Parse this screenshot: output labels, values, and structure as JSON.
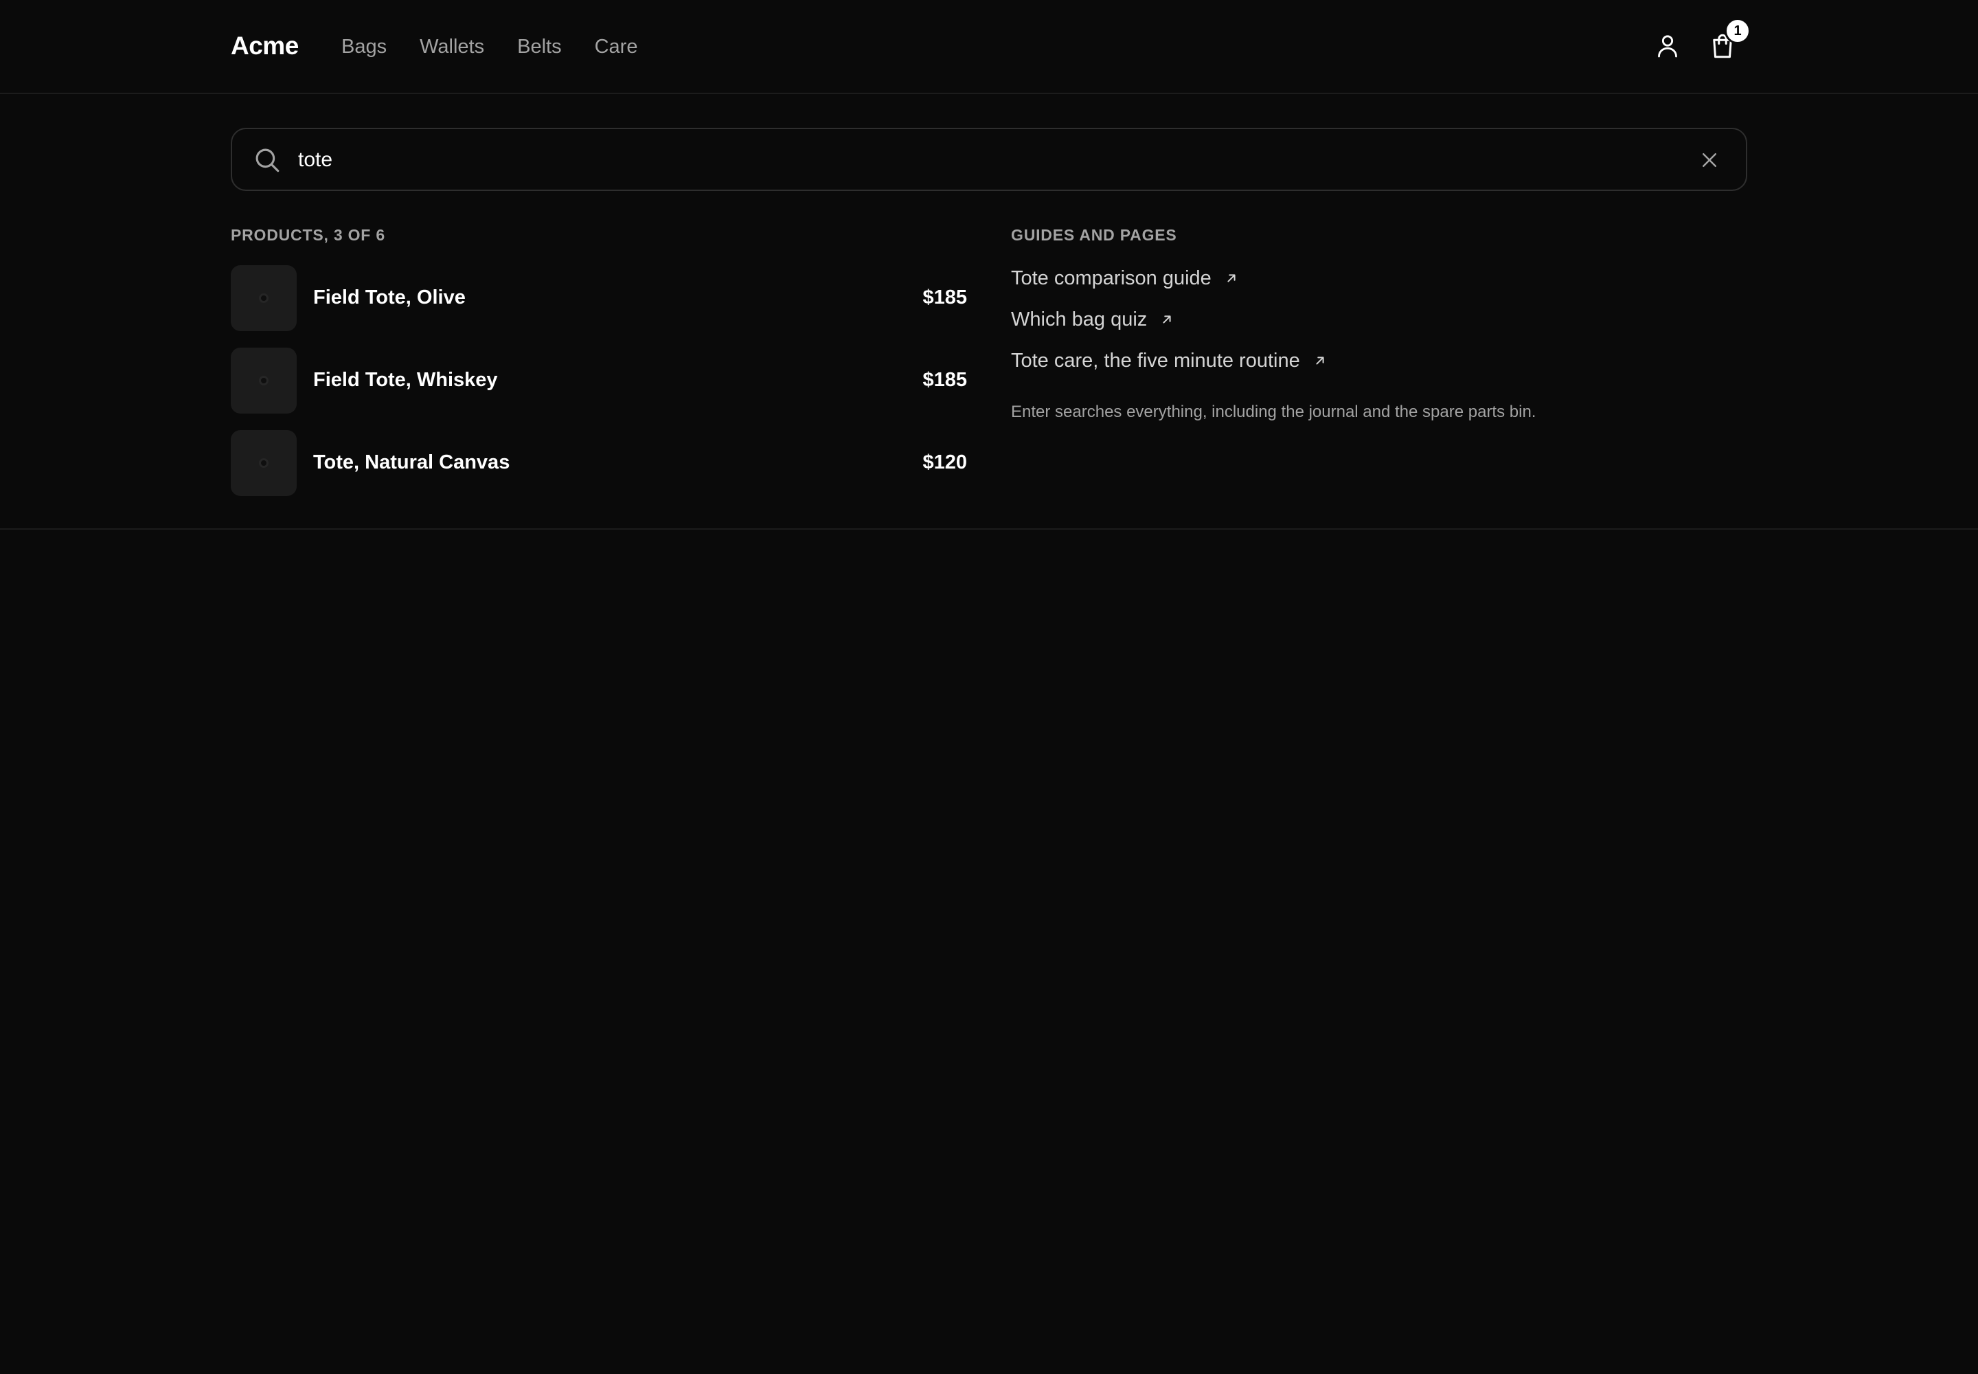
{
  "header": {
    "logo": "Acme",
    "nav": [
      "Bags",
      "Wallets",
      "Belts",
      "Care"
    ],
    "account_icon": "user-icon",
    "cart_icon": "shopping-bag-icon",
    "cart_count": "1"
  },
  "search": {
    "query": "tote",
    "search_icon": "search-icon",
    "clear_icon": "close-icon"
  },
  "products": {
    "heading": "PRODUCTS, 3 OF 6",
    "items": [
      {
        "name": "Field Tote, Olive",
        "price": "$185"
      },
      {
        "name": "Field Tote, Whiskey",
        "price": "$185"
      },
      {
        "name": "Tote, Natural Canvas",
        "price": "$120"
      }
    ]
  },
  "guides": {
    "heading": "GUIDES AND PAGES",
    "links": [
      "Tote comparison guide",
      "Which bag quiz",
      "Tote care, the five minute routine"
    ],
    "link_icon": "arrow-up-right-icon",
    "hint": "Enter searches everything, including the journal and the spare parts bin."
  },
  "colors": {
    "background": "#0a0a0a",
    "text_primary": "#ffffff",
    "text_muted": "#a3a3a3",
    "border": "#2e2e2e",
    "thumb": "#1c1c1c"
  }
}
